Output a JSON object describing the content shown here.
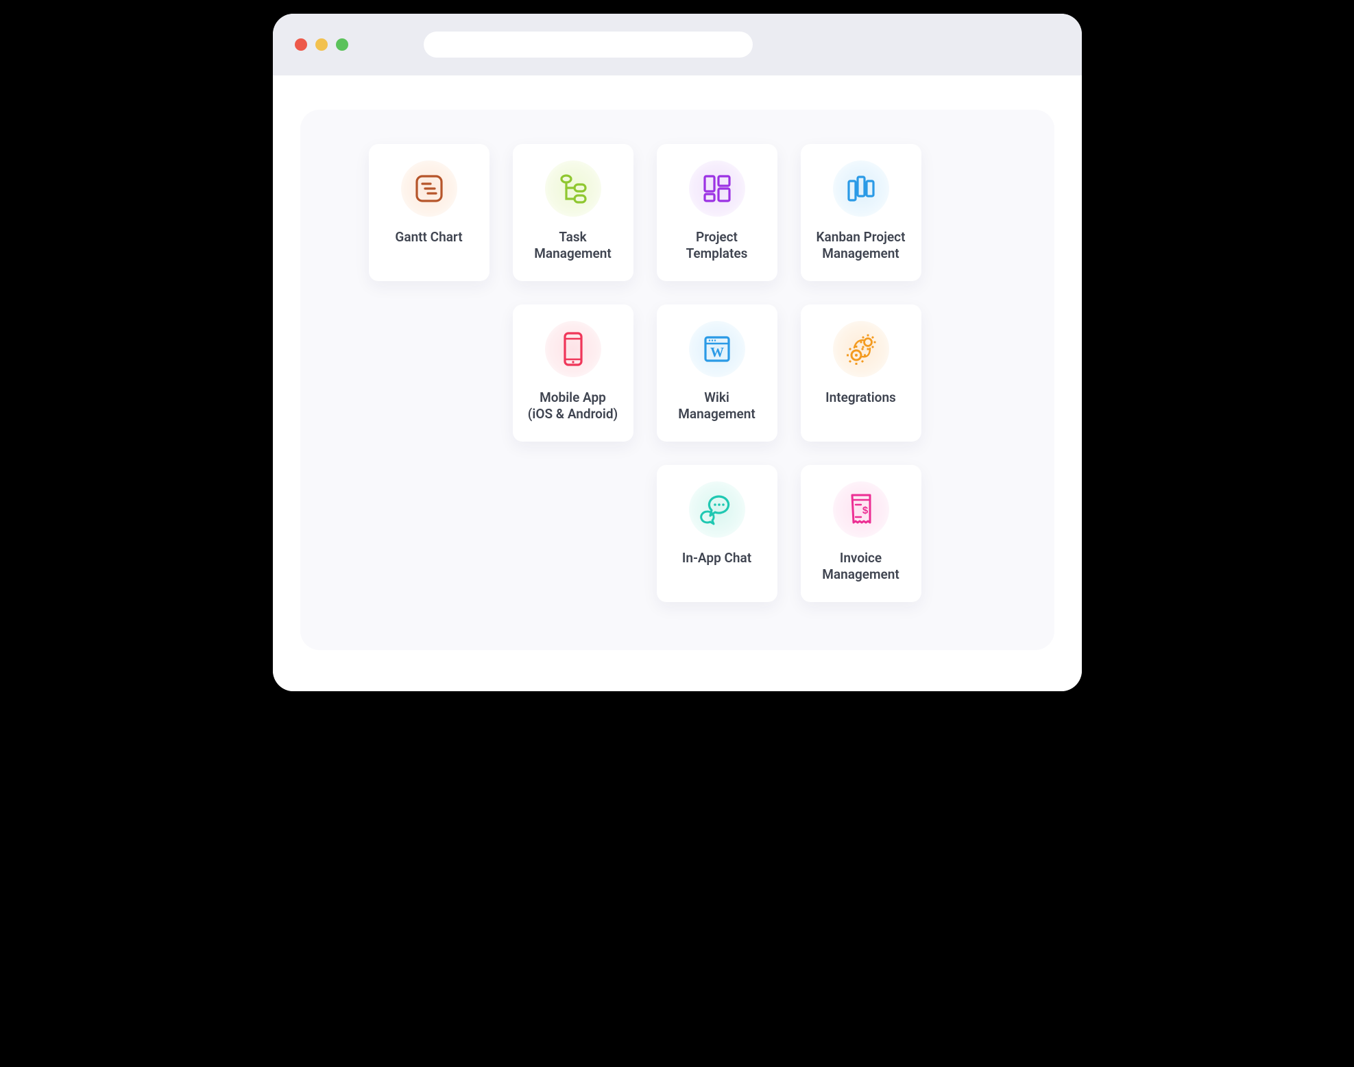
{
  "window": {
    "address_value": ""
  },
  "colors": {
    "gantt": "#b6552a",
    "task": "#8fc730",
    "templates": "#9b32e3",
    "kanban": "#2a9ae6",
    "mobile": "#ef3659",
    "wiki": "#2a9ae6",
    "integrations": "#f39a1f",
    "chat": "#20c8b2",
    "invoice": "#ec2e93"
  },
  "features": [
    {
      "id": "gantt",
      "label": "Gantt Chart",
      "icon": "gantt-icon"
    },
    {
      "id": "task",
      "label": "Task\nManagement",
      "icon": "task-tree-icon"
    },
    {
      "id": "templates",
      "label": "Project\nTemplates",
      "icon": "templates-grid-icon"
    },
    {
      "id": "kanban",
      "label": "Kanban Project\nManagement",
      "icon": "kanban-columns-icon"
    },
    {
      "id": "mobile",
      "label": "Mobile App\n(iOS & Android)",
      "icon": "mobile-phone-icon"
    },
    {
      "id": "wiki",
      "label": "Wiki\nManagement",
      "icon": "wiki-page-icon"
    },
    {
      "id": "integrations",
      "label": "Integrations",
      "icon": "integrations-gears-icon"
    },
    {
      "id": "chat",
      "label": "In-App Chat",
      "icon": "chat-bubble-icon"
    },
    {
      "id": "invoice",
      "label": "Invoice\nManagement",
      "icon": "invoice-receipt-icon"
    }
  ]
}
